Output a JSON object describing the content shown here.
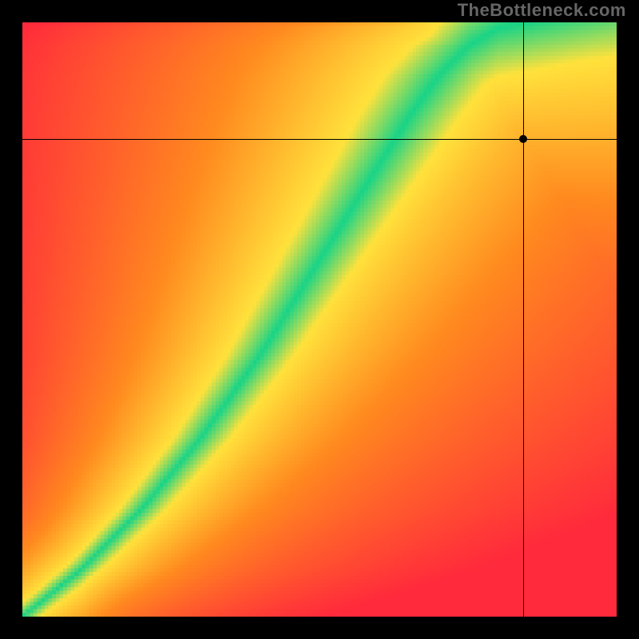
{
  "attribution": "TheBottleneck.com",
  "chart_data": {
    "type": "heatmap",
    "title": "",
    "xlabel": "",
    "ylabel": "",
    "xlim": [
      0,
      1
    ],
    "ylim": [
      0,
      1
    ],
    "grid": false,
    "legend": null,
    "color_scale_note": "Green = minimal bottleneck (best match), Yellow = moderate, Red = severe bottleneck. Gradient red→orange→yellow→green→yellow→orange→red across the matching diagonal.",
    "optimal_curve_description": "The green optimal band starts near the origin, curves slightly, and rises steeply toward the upper-right, indicating nonlinear matching between the two axes.",
    "crosshair_point": {
      "x": 0.843,
      "y": 0.804
    },
    "series": [
      {
        "name": "optimal_match_curve_center",
        "x": [
          0.0,
          0.05,
          0.1,
          0.15,
          0.2,
          0.25,
          0.3,
          0.35,
          0.4,
          0.45,
          0.5,
          0.55,
          0.6,
          0.65,
          0.7,
          0.75,
          0.8,
          0.85
        ],
        "values": [
          0.0,
          0.04,
          0.08,
          0.13,
          0.18,
          0.24,
          0.3,
          0.37,
          0.44,
          0.52,
          0.6,
          0.68,
          0.76,
          0.84,
          0.91,
          0.96,
          0.99,
          1.0
        ]
      }
    ]
  },
  "heatmap_render": {
    "resolution": 160,
    "colors": {
      "red": "#ff2a3c",
      "orange": "#ff8a1f",
      "yellow": "#ffe23c",
      "green": "#18d488"
    }
  }
}
